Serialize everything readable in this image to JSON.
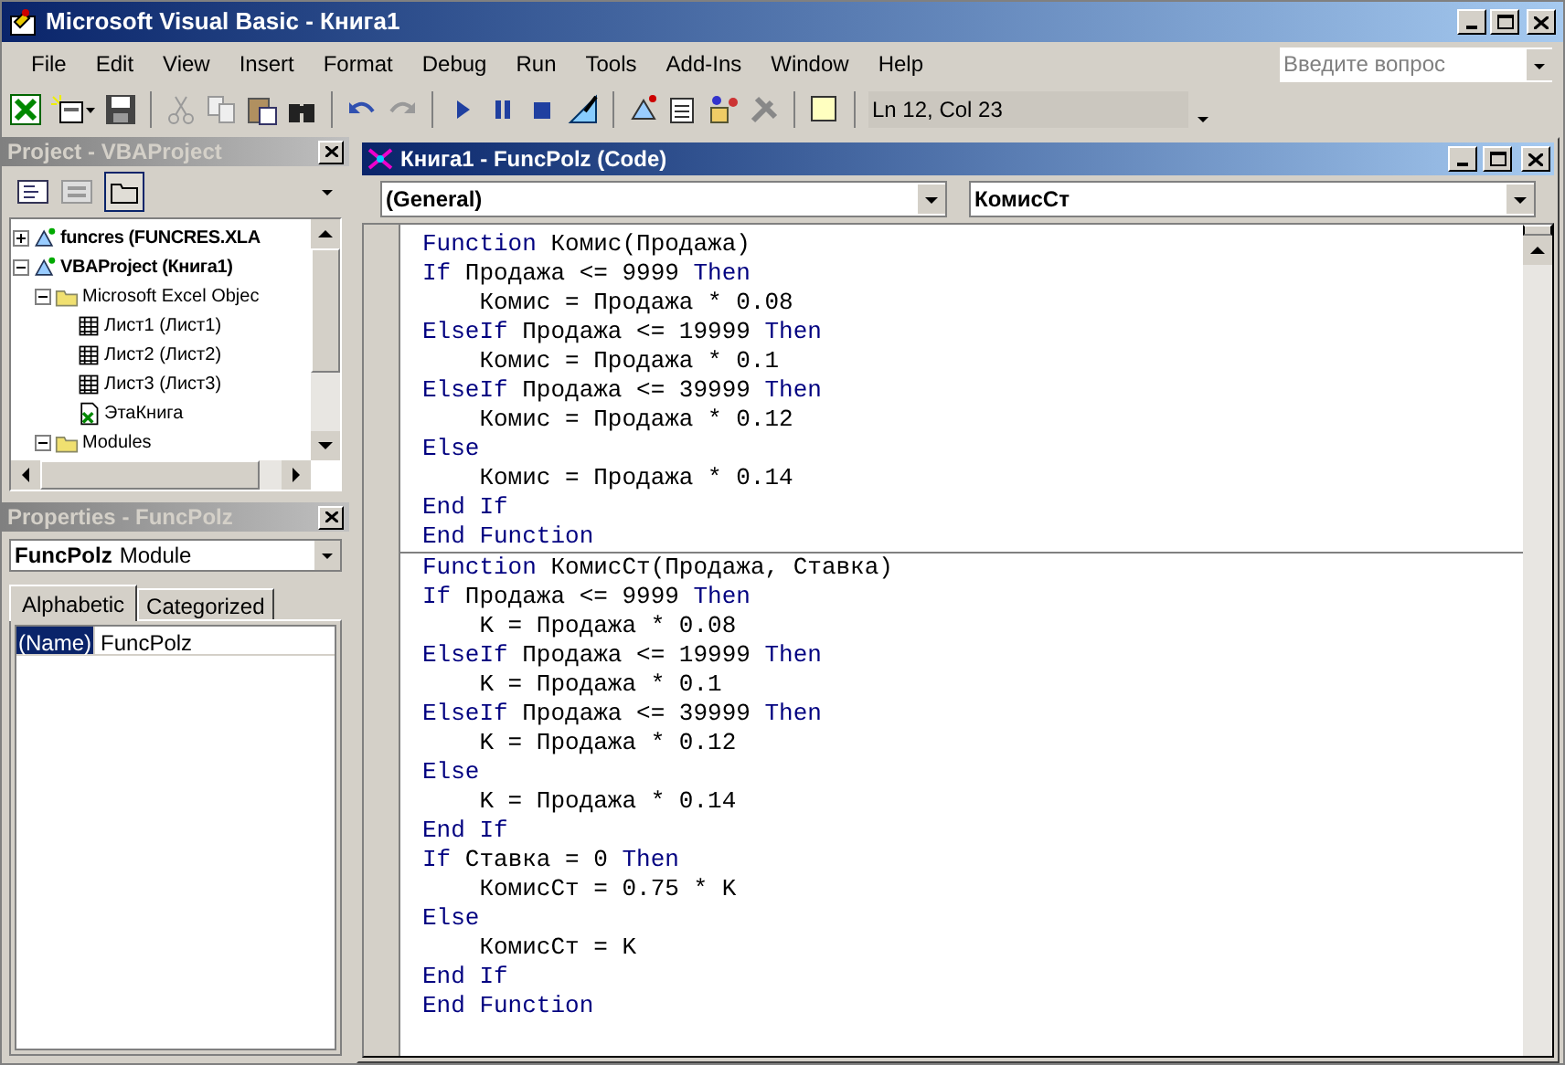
{
  "window": {
    "title": "Microsoft Visual Basic - Книга1"
  },
  "menu": [
    {
      "label": "File"
    },
    {
      "label": "Edit"
    },
    {
      "label": "View"
    },
    {
      "label": "Insert"
    },
    {
      "label": "Format"
    },
    {
      "label": "Debug"
    },
    {
      "label": "Run"
    },
    {
      "label": "Tools"
    },
    {
      "label": "Add-Ins"
    },
    {
      "label": "Window"
    },
    {
      "label": "Help"
    }
  ],
  "help_search": {
    "placeholder": "Введите вопрос"
  },
  "toolbar": {
    "position": "Ln 12, Col 23"
  },
  "project_pane": {
    "title": "Project - VBAProject",
    "tree": [
      {
        "label": "funcres (FUNCRES.XLA",
        "kind": "project",
        "expanded": false
      },
      {
        "label": "VBAProject (Книга1)",
        "kind": "project",
        "expanded": true,
        "children": [
          {
            "label": "Microsoft Excel Objec",
            "kind": "folder",
            "expanded": true,
            "children": [
              {
                "label": "Лист1 (Лист1)",
                "kind": "sheet"
              },
              {
                "label": "Лист2 (Лист2)",
                "kind": "sheet"
              },
              {
                "label": "Лист3 (Лист3)",
                "kind": "sheet"
              },
              {
                "label": "ЭтаКнига",
                "kind": "workbook"
              }
            ]
          },
          {
            "label": "Modules",
            "kind": "folder",
            "expanded": true
          }
        ]
      }
    ]
  },
  "properties_pane": {
    "title": "Properties - FuncPolz",
    "object": {
      "name": "FuncPolz",
      "type": "Module"
    },
    "tabs": [
      {
        "label": "Alphabetic",
        "selected": true
      },
      {
        "label": "Categorized",
        "selected": false
      }
    ],
    "rows": [
      {
        "name": "(Name)",
        "value": "FuncPolz",
        "selected": true
      }
    ]
  },
  "code_window": {
    "title": "Книга1 - FuncPolz (Code)",
    "object_box": "(General)",
    "procedure_box": "КомисСт",
    "procedures": [
      {
        "lines": [
          [
            {
              "kind": "keyword",
              "text": "Function"
            },
            {
              "kind": "plain",
              "text": " Комис(Продажа)"
            }
          ],
          [
            {
              "kind": "keyword",
              "text": "If"
            },
            {
              "kind": "plain",
              "text": " Продажа <= 9999 "
            },
            {
              "kind": "keyword",
              "text": "Then"
            }
          ],
          [
            {
              "kind": "plain",
              "text": "    Комис = Продажа * 0.08"
            }
          ],
          [
            {
              "kind": "keyword",
              "text": "ElseIf"
            },
            {
              "kind": "plain",
              "text": " Продажа <= 19999 "
            },
            {
              "kind": "keyword",
              "text": "Then"
            }
          ],
          [
            {
              "kind": "plain",
              "text": "    Комис = Продажа * 0.1"
            }
          ],
          [
            {
              "kind": "keyword",
              "text": "ElseIf"
            },
            {
              "kind": "plain",
              "text": " Продажа <= 39999 "
            },
            {
              "kind": "keyword",
              "text": "Then"
            }
          ],
          [
            {
              "kind": "plain",
              "text": "    Комис = Продажа * 0.12"
            }
          ],
          [
            {
              "kind": "keyword",
              "text": "Else"
            }
          ],
          [
            {
              "kind": "plain",
              "text": "    Комис = Продажа * 0.14"
            }
          ],
          [
            {
              "kind": "keyword",
              "text": "End If"
            }
          ],
          [
            {
              "kind": "keyword",
              "text": "End Function"
            }
          ]
        ]
      },
      {
        "lines": [
          [
            {
              "kind": "keyword",
              "text": "Function"
            },
            {
              "kind": "plain",
              "text": " КомисСт(Продажа, Ставка)"
            }
          ],
          [
            {
              "kind": "keyword",
              "text": "If"
            },
            {
              "kind": "plain",
              "text": " Продажа <= 9999 "
            },
            {
              "kind": "keyword",
              "text": "Then"
            }
          ],
          [
            {
              "kind": "plain",
              "text": "    K = Продажа * 0.08"
            }
          ],
          [
            {
              "kind": "keyword",
              "text": "ElseIf"
            },
            {
              "kind": "plain",
              "text": " Продажа <= 19999 "
            },
            {
              "kind": "keyword",
              "text": "Then"
            }
          ],
          [
            {
              "kind": "plain",
              "text": "    K = Продажа * 0.1"
            }
          ],
          [
            {
              "kind": "keyword",
              "text": "ElseIf"
            },
            {
              "kind": "plain",
              "text": " Продажа <= 39999 "
            },
            {
              "kind": "keyword",
              "text": "Then"
            }
          ],
          [
            {
              "kind": "plain",
              "text": "    K = Продажа * 0.12"
            }
          ],
          [
            {
              "kind": "keyword",
              "text": "Else"
            }
          ],
          [
            {
              "kind": "plain",
              "text": "    K = Продажа * 0.14"
            }
          ],
          [
            {
              "kind": "keyword",
              "text": "End If"
            }
          ],
          [
            {
              "kind": "keyword",
              "text": "If"
            },
            {
              "kind": "plain",
              "text": " Ставка = 0 "
            },
            {
              "kind": "keyword",
              "text": "Then"
            }
          ],
          [
            {
              "kind": "plain",
              "text": "    КомисСт = 0.75 * K"
            }
          ],
          [
            {
              "kind": "keyword",
              "text": "Else"
            }
          ],
          [
            {
              "kind": "plain",
              "text": "    КомисСт = K"
            }
          ],
          [
            {
              "kind": "keyword",
              "text": "End If"
            }
          ],
          [
            {
              "kind": "keyword",
              "text": "End Function"
            }
          ]
        ]
      }
    ]
  }
}
